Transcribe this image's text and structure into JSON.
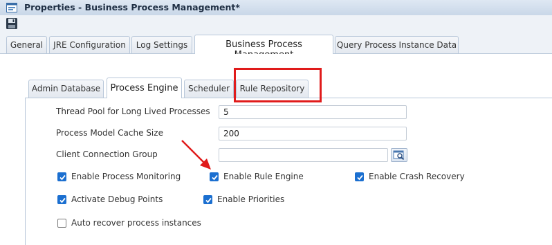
{
  "window": {
    "title": "Properties - Business Process Management*"
  },
  "toolbar": {
    "save_icon": "save-icon"
  },
  "outer_tabs": [
    {
      "label": "General"
    },
    {
      "label": "JRE Configuration"
    },
    {
      "label": "Log Settings"
    },
    {
      "label": "Business Process Management",
      "active": true
    },
    {
      "label": "Query Process Instance Data"
    }
  ],
  "inner_tabs": [
    {
      "label": "Admin Database"
    },
    {
      "label": "Process Engine",
      "active": true
    },
    {
      "label": "Scheduler"
    },
    {
      "label": "Rule Repository"
    }
  ],
  "fields": {
    "thread_pool": {
      "label": "Thread Pool for Long Lived Processes",
      "value": "5"
    },
    "cache_size": {
      "label": "Process Model Cache Size",
      "value": "200"
    },
    "client_group": {
      "label": "Client Connection Group",
      "value": ""
    }
  },
  "checkboxes": {
    "process_monitoring": {
      "label": "Enable Process Monitoring",
      "checked": true
    },
    "rule_engine": {
      "label": "Enable Rule Engine",
      "checked": true
    },
    "crash_recovery": {
      "label": "Enable Crash Recovery",
      "checked": true
    },
    "debug_points": {
      "label": "Activate Debug Points",
      "checked": true
    },
    "priorities": {
      "label": "Enable Priorities",
      "checked": true
    },
    "auto_recover": {
      "label": "Auto recover process instances",
      "checked": false
    }
  },
  "colors": {
    "accent": "#1b6fd0",
    "highlight": "#e01b1b",
    "annotation": "#e01b1b"
  }
}
